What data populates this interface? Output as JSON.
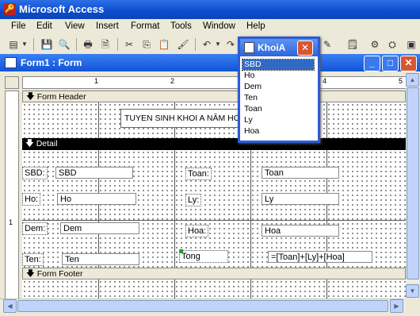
{
  "app": {
    "title": "Microsoft Access"
  },
  "menu": [
    "File",
    "Edit",
    "View",
    "Insert",
    "Format",
    "Tools",
    "Window",
    "Help"
  ],
  "form_window": {
    "title": "Form1 : Form"
  },
  "sections": {
    "header": "Form Header",
    "detail": "Detail",
    "footer": "Form Footer"
  },
  "header_label": "TUYEN SINH KHOI A NĂM HO",
  "fields_left": [
    {
      "label": "SBD:",
      "value": "SBD"
    },
    {
      "label": "Ho:",
      "value": "Ho"
    },
    {
      "label": "Dem:",
      "value": "Dem"
    },
    {
      "label": "Ten:",
      "value": "Ten"
    }
  ],
  "fields_right": [
    {
      "label": "Toan:",
      "value": "Toan"
    },
    {
      "label": "Ly:",
      "value": "Ly"
    },
    {
      "label": "Hoa:",
      "value": "Hoa"
    },
    {
      "label": "Tong",
      "value": "=[Toan]+[Ly]+[Hoa]"
    }
  ],
  "ruler_numbers": [
    "1",
    "2",
    "3",
    "4",
    "5"
  ],
  "vruler_numbers": [
    "1"
  ],
  "field_list": {
    "title": "KhoiA",
    "items": [
      "SBD",
      "Ho",
      "Dem",
      "Ten",
      "Toan",
      "Ly",
      "Hoa"
    ],
    "selected": "SBD"
  }
}
